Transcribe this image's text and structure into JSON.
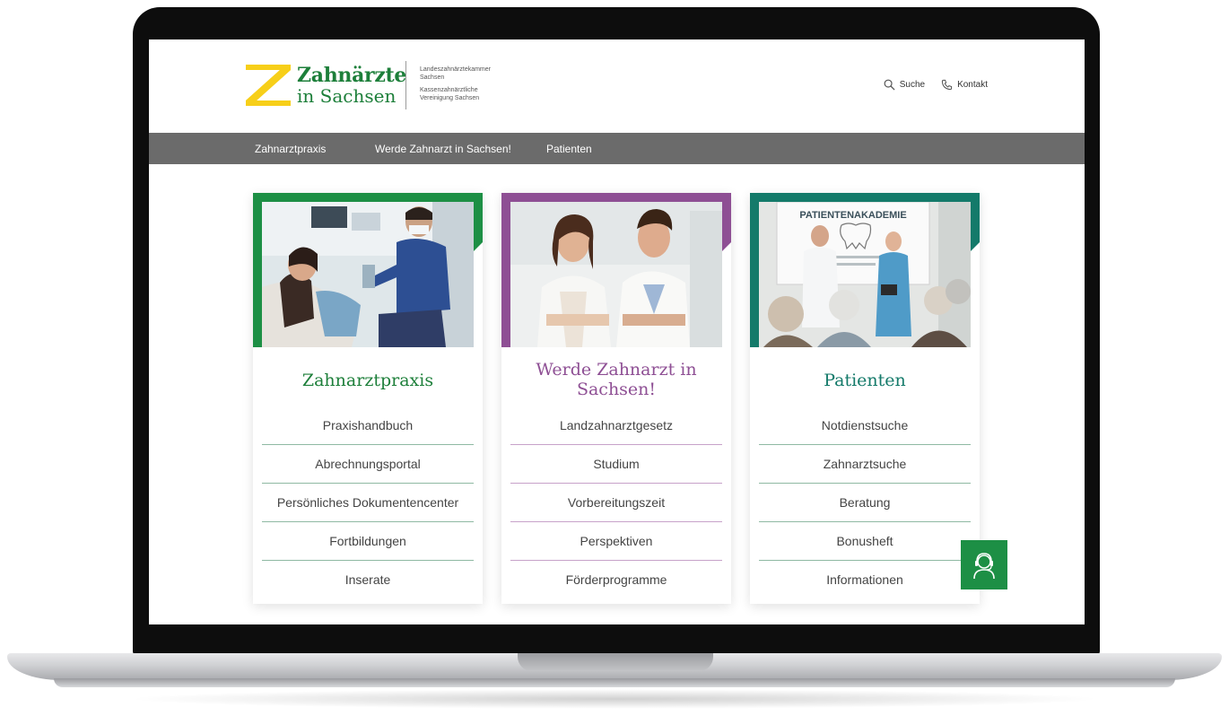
{
  "colors": {
    "brand_green": "#1d7f3a",
    "accent_yellow": "#f7cf19",
    "nav_gray": "#6b6b6b",
    "card_green": "#1d8f45",
    "card_purple": "#8e4f94",
    "card_teal": "#147a6a"
  },
  "header": {
    "logo_title": "Zahnärzte",
    "logo_subtitle": "in Sachsen",
    "org_lines": [
      "Landeszahnärztekammer",
      "Sachsen",
      "Kassenzahnärztliche",
      "Vereinigung Sachsen"
    ],
    "search_label": "Suche",
    "contact_label": "Kontakt",
    "search_icon": "search-icon",
    "contact_icon": "phone-icon"
  },
  "nav": {
    "items": [
      {
        "label": "Zahnarztpraxis"
      },
      {
        "label": "Werde Zahnarzt in Sachsen!"
      },
      {
        "label": "Patienten"
      }
    ]
  },
  "cards": [
    {
      "title": "Zahnarztpraxis",
      "accent": "#1d8f45",
      "links": [
        "Praxishandbuch",
        "Abrechnungsportal",
        "Persönliches Dokumentencenter",
        "Fortbildungen",
        "Inserate"
      ]
    },
    {
      "title_line1": "Werde Zahnarzt in",
      "title_line2": "Sachsen!",
      "accent": "#8e4f94",
      "links": [
        "Landzahnarztgesetz",
        "Studium",
        "Vorbereitungszeit",
        "Perspektiven",
        "Förderprogramme"
      ]
    },
    {
      "title": "Patienten",
      "accent": "#147a6a",
      "photo_sign": "PATIENTENAKADEMIE",
      "links": [
        "Notdienstsuche",
        "Zahnarztsuche",
        "Beratung",
        "Bonusheft",
        "Informationen"
      ]
    }
  ],
  "chat": {
    "icon": "support-agent-icon"
  }
}
